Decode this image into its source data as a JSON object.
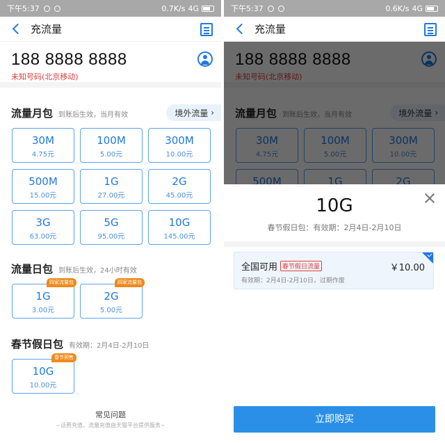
{
  "status": {
    "time": "下午5:37",
    "left_speed": "0.7K/s",
    "right_speed": "0.6K/s",
    "network": "4G"
  },
  "nav": {
    "title": "充流量"
  },
  "account": {
    "phone": "188 8888 8888",
    "carrier": "未知号码(北京移动)"
  },
  "monthly": {
    "title": "流量月包",
    "subtitle": "到账后生效，当月有效",
    "overseas": "境外流量",
    "items": [
      {
        "size": "30M",
        "price": "4.75元"
      },
      {
        "size": "100M",
        "price": "5.00元"
      },
      {
        "size": "300M",
        "price": "10.00元"
      },
      {
        "size": "500M",
        "price": "15.00元"
      },
      {
        "size": "1G",
        "price": "27.00元"
      },
      {
        "size": "2G",
        "price": "45.00元"
      },
      {
        "size": "3G",
        "price": "63.00元"
      },
      {
        "size": "5G",
        "price": "95.00元"
      },
      {
        "size": "10G",
        "price": "145.00元"
      }
    ]
  },
  "daily": {
    "title": "流量日包",
    "subtitle": "到账后生效，24小时有效",
    "items": [
      {
        "size": "1G",
        "price": "3.00元",
        "tag": "四家流量包"
      },
      {
        "size": "2G",
        "price": "5.00元",
        "tag": "四家流量包"
      }
    ]
  },
  "holiday": {
    "title": "春节假日包",
    "subtitle": "有效期：2月4日-2月10日",
    "items": [
      {
        "size": "10G",
        "price": "10.00元",
        "tag": "春节预售"
      }
    ]
  },
  "faq": {
    "label": "常见问题",
    "note": "~话费充值、流量充值由天猫平台提供服务~"
  },
  "sheet": {
    "size": "10G",
    "desc": "春节假日包：有效期：2月4日-2月10日",
    "option_title": "全国可用",
    "option_badge": "春节假日流量",
    "option_price": "￥10.00",
    "option_valid": "有效期：2月4日-2月10日，过期作废",
    "buy": "立即购买"
  },
  "colors": {
    "accent": "#1f78e0",
    "button": "#2b8fe8",
    "tag": "#ef8a1b",
    "carrier": "#e23b3b"
  }
}
